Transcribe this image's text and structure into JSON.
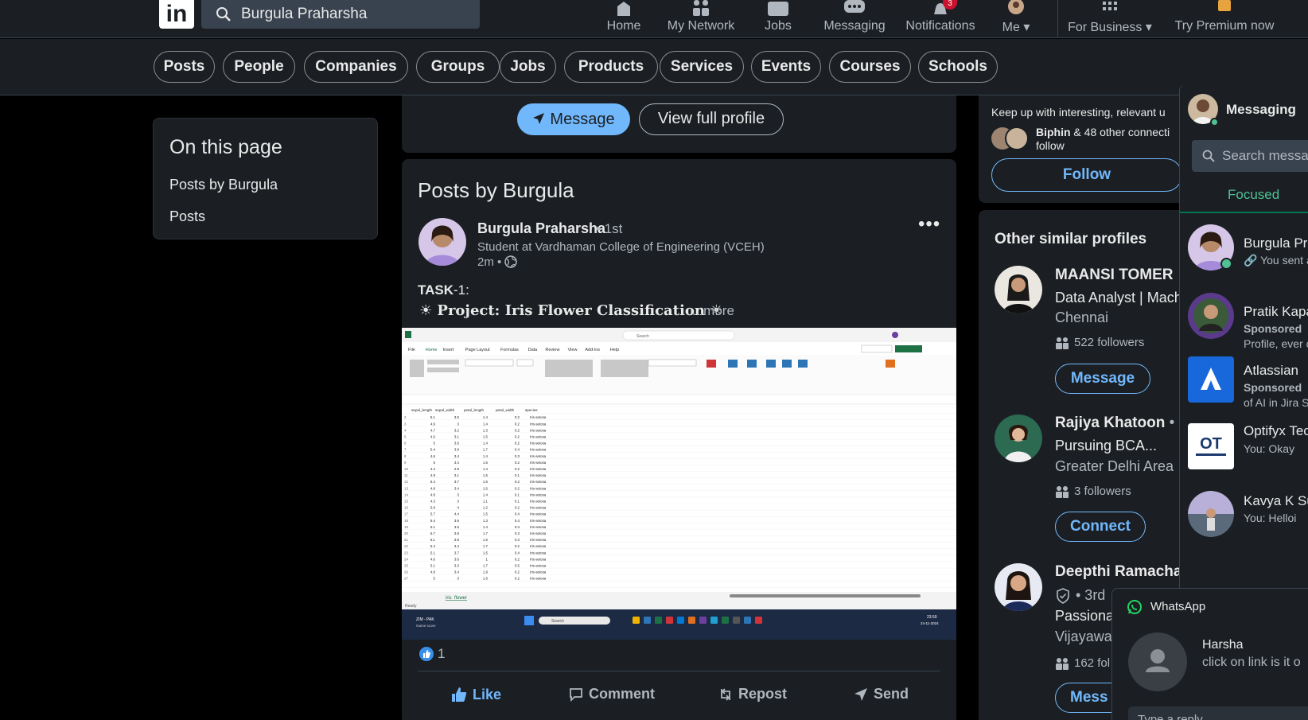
{
  "topnav": {
    "logo": "in",
    "search_value": "Burgula Praharsha",
    "items": [
      {
        "label": "Home",
        "icon": "home-icon"
      },
      {
        "label": "My Network",
        "icon": "network-icon"
      },
      {
        "label": "Jobs",
        "icon": "briefcase-icon"
      },
      {
        "label": "Messaging",
        "icon": "chat-icon"
      },
      {
        "label": "Notifications",
        "icon": "bell-icon",
        "badge": "3"
      },
      {
        "label": "Me",
        "icon": "avatar"
      },
      {
        "label": "For Business",
        "icon": "grid-icon"
      },
      {
        "label": "Try Premium now",
        "icon": "premium-icon"
      }
    ]
  },
  "filters": [
    "Posts",
    "People",
    "Companies",
    "Groups",
    "Jobs",
    "Products",
    "Services",
    "Events",
    "Courses",
    "Schools"
  ],
  "on_this_page": {
    "title": "On this page",
    "links": [
      "Posts by Burgula",
      "Posts"
    ]
  },
  "profile_actions": {
    "message": "Message",
    "view_profile": "View full profile"
  },
  "post": {
    "section_title": "Posts by Burgula",
    "author": "Burgula Praharsha",
    "degree": "• 1st",
    "headline": "Student at Vardhaman College of Engineering (VCEH)",
    "time": "2m •",
    "task_label": "TASK",
    "task_rest": "-1:",
    "project": "Project: Iris Flower Classification",
    "more": "...more",
    "reaction_count": "1",
    "actions": {
      "like": "Like",
      "comment": "Comment",
      "repost": "Repost",
      "send": "Send"
    }
  },
  "spreadsheet": {
    "headers": [
      "sepal_length",
      "sepal_width",
      "petal_length",
      "petal_width",
      "species"
    ],
    "rows": [
      [
        "5.1",
        "3.5",
        "1.4",
        "0.2",
        "Iris-setosa"
      ],
      [
        "4.9",
        "3",
        "1.4",
        "0.2",
        "Iris-setosa"
      ],
      [
        "4.7",
        "3.2",
        "1.3",
        "0.2",
        "Iris-setosa"
      ],
      [
        "4.6",
        "3.1",
        "1.5",
        "0.2",
        "Iris-setosa"
      ],
      [
        "5",
        "3.6",
        "1.4",
        "0.2",
        "Iris-setosa"
      ],
      [
        "5.4",
        "3.9",
        "1.7",
        "0.4",
        "Iris-setosa"
      ],
      [
        "4.6",
        "3.4",
        "1.4",
        "0.3",
        "Iris-setosa"
      ],
      [
        "5",
        "3.4",
        "1.5",
        "0.2",
        "Iris-setosa"
      ],
      [
        "4.4",
        "2.9",
        "1.4",
        "0.2",
        "Iris-setosa"
      ],
      [
        "4.9",
        "3.1",
        "1.5",
        "0.1",
        "Iris-setosa"
      ],
      [
        "5.4",
        "3.7",
        "1.5",
        "0.2",
        "Iris-setosa"
      ],
      [
        "4.8",
        "3.4",
        "1.6",
        "0.2",
        "Iris-setosa"
      ],
      [
        "4.8",
        "3",
        "1.4",
        "0.1",
        "Iris-setosa"
      ],
      [
        "4.3",
        "3",
        "1.1",
        "0.1",
        "Iris-setosa"
      ],
      [
        "5.8",
        "4",
        "1.2",
        "0.2",
        "Iris-setosa"
      ],
      [
        "5.7",
        "4.4",
        "1.5",
        "0.4",
        "Iris-setosa"
      ],
      [
        "5.4",
        "3.9",
        "1.3",
        "0.4",
        "Iris-setosa"
      ],
      [
        "5.1",
        "3.5",
        "1.4",
        "0.3",
        "Iris-setosa"
      ],
      [
        "5.7",
        "3.8",
        "1.7",
        "0.3",
        "Iris-setosa"
      ],
      [
        "5.1",
        "3.8",
        "1.5",
        "0.3",
        "Iris-setosa"
      ],
      [
        "5.4",
        "3.4",
        "1.7",
        "0.2",
        "Iris-setosa"
      ],
      [
        "5.1",
        "3.7",
        "1.5",
        "0.4",
        "Iris-setosa"
      ],
      [
        "4.6",
        "3.6",
        "1",
        "0.2",
        "Iris-setosa"
      ],
      [
        "5.1",
        "3.3",
        "1.7",
        "0.5",
        "Iris-setosa"
      ],
      [
        "4.8",
        "3.4",
        "1.9",
        "0.2",
        "Iris-setosa"
      ],
      [
        "5",
        "3",
        "1.6",
        "0.2",
        "Iris-setosa"
      ]
    ],
    "sheet_tab": "iris_flower",
    "ribbon_tabs": [
      "File",
      "Home",
      "Insert",
      "Page Layout",
      "Formulas",
      "Data",
      "Review",
      "View",
      "Add-ins",
      "Help"
    ],
    "status": "Ready",
    "taskbar_left": "ZIM - PAK",
    "taskbar_sub": "Game score",
    "clock": "23:59",
    "date": "24-11-2024",
    "search": "Search"
  },
  "right": {
    "keep_up": "Keep up with interesting, relevant u",
    "mutual_name": "Biphin",
    "mutual_rest": " & 48 other connecti",
    "mutual_rest2": "follow",
    "follow": "Follow",
    "similar_title": "Other similar profiles",
    "profiles": [
      {
        "name": "MAANSI TOMER",
        "sub": "Data Analyst | Machi",
        "loc": "Chennai",
        "followers": "522 followers",
        "button": "Message"
      },
      {
        "name": "Rajiya Khatoon",
        "sub": "Pursuing BCA...",
        "loc": "Greater Delhi Area",
        "followers": "3 followers",
        "button": "Connect"
      },
      {
        "name": "Deepthi Ramacha",
        "sub": "Passionat",
        "loc": "Vijayawa",
        "followers": "162 fol",
        "degree": "• 3rd",
        "button": "Mess"
      }
    ]
  },
  "messaging": {
    "title": "Messaging",
    "search_placeholder": "Search messag",
    "tab": "Focused",
    "conversations": [
      {
        "name": "Burgula Pra",
        "sub": "You sent a"
      },
      {
        "name": "Pratik Kapa",
        "sponsored": "Sponsored",
        "sub": "Profile, ever c"
      },
      {
        "name": "Atlassian",
        "sponsored": "Sponsored",
        "sub": "of AI in Jira S"
      },
      {
        "name": "Optifyx Tec",
        "sub": "You: Okay"
      },
      {
        "name": "Kavya K Su",
        "sub": "You: Helloi"
      }
    ]
  },
  "whatsapp": {
    "title": "WhatsApp",
    "name": "Harsha",
    "message": "click on link is it o",
    "reply_placeholder": "Type a reply"
  },
  "colors": {
    "accent": "#71b7fb",
    "bg": "#000000",
    "card": "#1b1f23",
    "green": "#01754f"
  }
}
